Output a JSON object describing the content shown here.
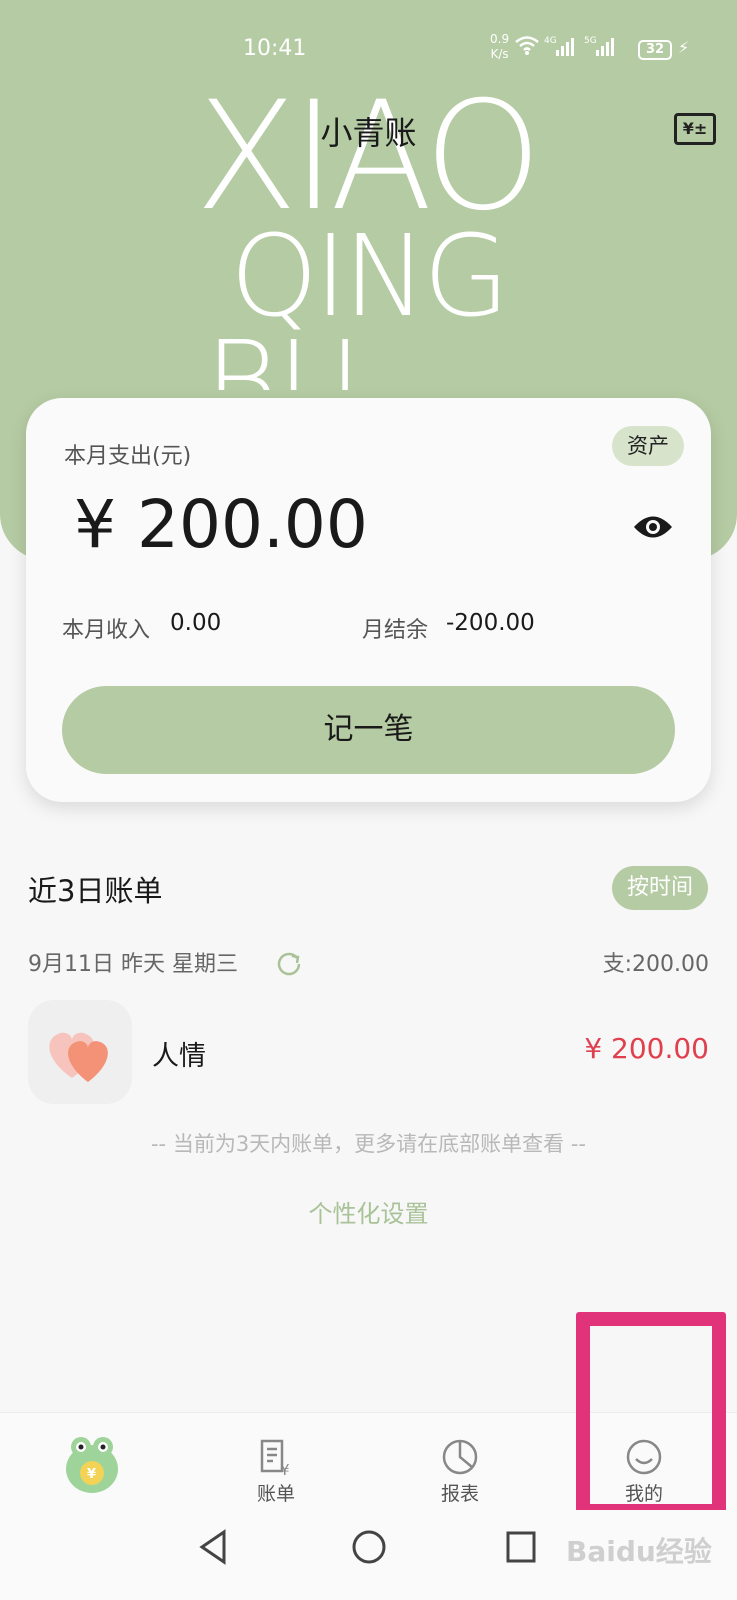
{
  "status_bar": {
    "time": "10:41",
    "net_speed_value": "0.9",
    "net_speed_unit": "K/s",
    "battery": "32",
    "sig1_label": "4G",
    "sig2_label": "5G"
  },
  "header": {
    "title": "小青账",
    "watermark_line1": "XIAO",
    "watermark_line2": "QING",
    "watermark_line3": "BU",
    "calc_icon_text": "¥±"
  },
  "summary_card": {
    "label": "本月支出(元)",
    "assets_button": "资产",
    "amount": "¥ 200.00",
    "income_label": "本月收入",
    "income_value": "0.00",
    "balance_label": "月结余",
    "balance_value": "-200.00",
    "record_button": "记一笔"
  },
  "recent": {
    "title": "近3日账单",
    "sort_button": "按时间",
    "day_header": "9月11日  昨天 星期三",
    "day_total": "支:200.00",
    "items": [
      {
        "icon": "heart-icon",
        "name": "人情",
        "amount": "¥ 200.00"
      }
    ],
    "hint": "-- 当前为3天内账单，更多请在底部账单查看 --",
    "settings_link": "个性化设置"
  },
  "tabbar": {
    "tabs": [
      {
        "label": "",
        "icon": "mascot-icon"
      },
      {
        "label": "账单",
        "icon": "bill-icon"
      },
      {
        "label": "报表",
        "icon": "pie-chart-icon"
      },
      {
        "label": "我的",
        "icon": "smile-icon"
      }
    ]
  },
  "watermark_text": "Baidu经验",
  "colors": {
    "brand_green": "#b5cba3",
    "expense_red": "#e0404e",
    "highlight": "#e0337a"
  }
}
